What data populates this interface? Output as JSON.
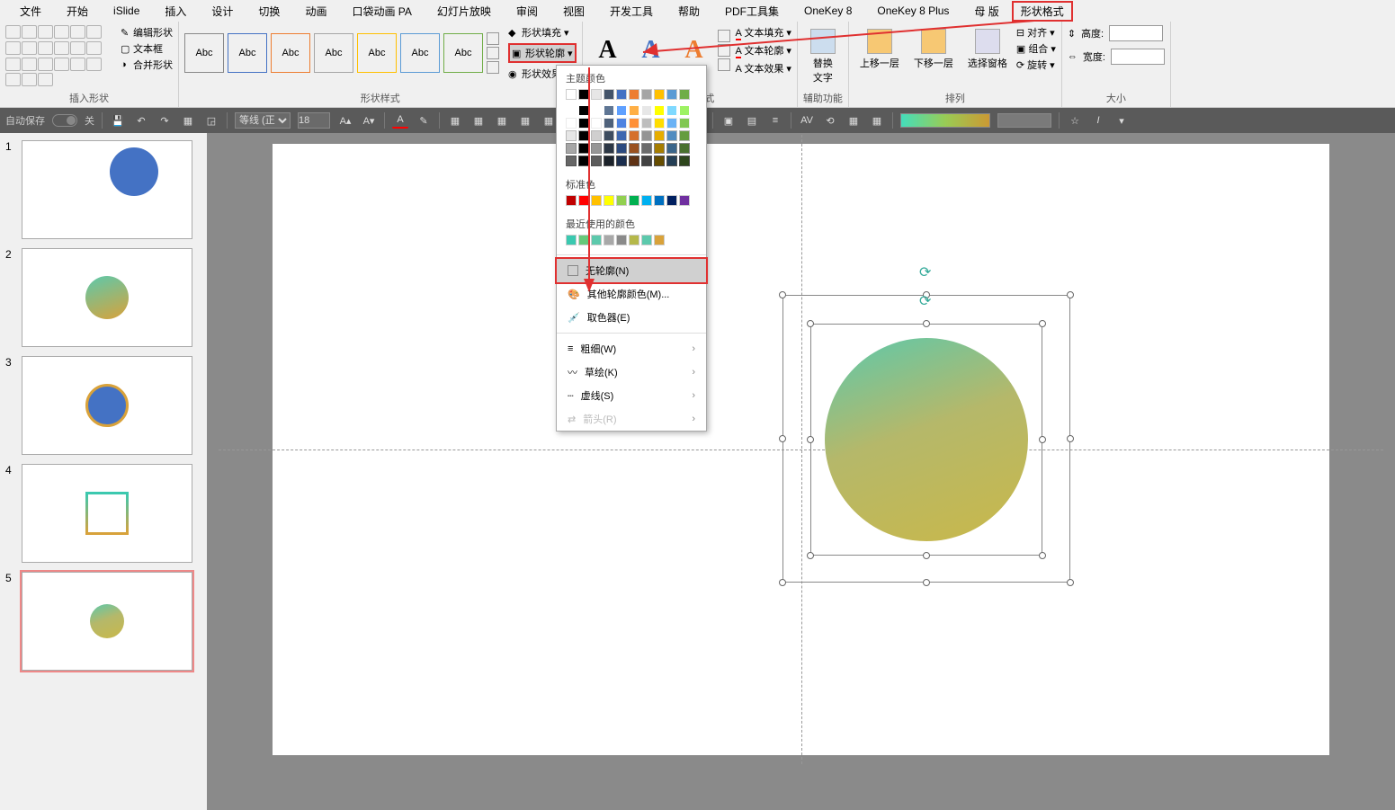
{
  "menu": [
    "文件",
    "开始",
    "iSlide",
    "插入",
    "设计",
    "切换",
    "动画",
    "口袋动画 PA",
    "幻灯片放映",
    "审阅",
    "视图",
    "开发工具",
    "帮助",
    "PDF工具集",
    "OneKey 8",
    "OneKey 8 Plus",
    "母   版"
  ],
  "menu_active": "形状格式",
  "ribbon": {
    "shapes_side": {
      "a": "编辑形状",
      "b": "文本框",
      "c": "合并形状"
    },
    "g1_label": "插入形状",
    "style_abc": "Abc",
    "fill": "形状填充",
    "outline": "形状轮廓",
    "effect": "形状效果",
    "g2_label": "形状样式",
    "wa_fill": "文本填充",
    "wa_outline": "文本轮廓",
    "wa_effect": "文本效果",
    "g3_label": "艺术字样式",
    "replace": "替换\n文字",
    "g4_label": "辅助功能",
    "up": "上移一层",
    "down": "下移一层",
    "pane": "选择窗格",
    "align": "对齐",
    "group": "组合",
    "rotate": "旋转",
    "g5_label": "排列",
    "height": "高度:",
    "width": "宽度:",
    "g6_label": "大小"
  },
  "qat": {
    "autosave": "自动保存",
    "off": "关",
    "lineweight": "等线 (正",
    "fontsize": "18"
  },
  "popup": {
    "theme": "主题颜色",
    "standard": "标准色",
    "recent": "最近使用的颜色",
    "none": "无轮廓(N)",
    "more": "其他轮廓颜色(M)...",
    "eyedrop": "取色器(E)",
    "weight": "粗细(W)",
    "sketch": "草绘(K)",
    "dash": "虚线(S)",
    "arrows": "箭头(R)",
    "theme_colors": [
      "#ffffff",
      "#000000",
      "#e7e6e6",
      "#44546a",
      "#4472c4",
      "#ed7d31",
      "#a5a5a5",
      "#ffc000",
      "#5b9bd5",
      "#70ad47"
    ],
    "std_colors": [
      "#c00000",
      "#ff0000",
      "#ffc000",
      "#ffff00",
      "#92d050",
      "#00b050",
      "#00b0f0",
      "#0070c0",
      "#002060",
      "#7030a0"
    ],
    "recent_colors": [
      "#3ac9b0",
      "#66c97a",
      "#5cc9ac",
      "#a8a8a8",
      "#8a8a8a",
      "#b5b84a",
      "#5cc9ac",
      "#d9a23a"
    ]
  },
  "slides": [
    1,
    2,
    3,
    4,
    5
  ]
}
